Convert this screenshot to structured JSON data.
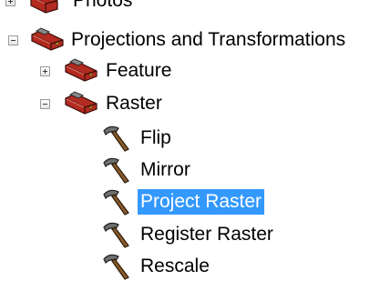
{
  "tree": {
    "nodes": [
      {
        "label": "Photos",
        "type": "toolset",
        "state": "collapsed"
      },
      {
        "label": "Projections and Transformations",
        "type": "toolset",
        "state": "expanded"
      },
      {
        "label": "Feature",
        "type": "toolset",
        "state": "collapsed"
      },
      {
        "label": "Raster",
        "type": "toolset",
        "state": "expanded"
      },
      {
        "label": "Flip",
        "type": "tool"
      },
      {
        "label": "Mirror",
        "type": "tool"
      },
      {
        "label": "Project Raster",
        "type": "tool",
        "selected": true
      },
      {
        "label": "Register Raster",
        "type": "tool"
      },
      {
        "label": "Rescale",
        "type": "tool"
      }
    ]
  },
  "colors": {
    "selection_background": "#3399ff",
    "selection_text": "#ffffff",
    "toolbox_red": "#c0392b"
  },
  "icons": {
    "toolset": "toolbox-icon",
    "tool": "hammer-icon",
    "expanded": "minus-toggle-icon",
    "collapsed": "plus-toggle-icon"
  }
}
